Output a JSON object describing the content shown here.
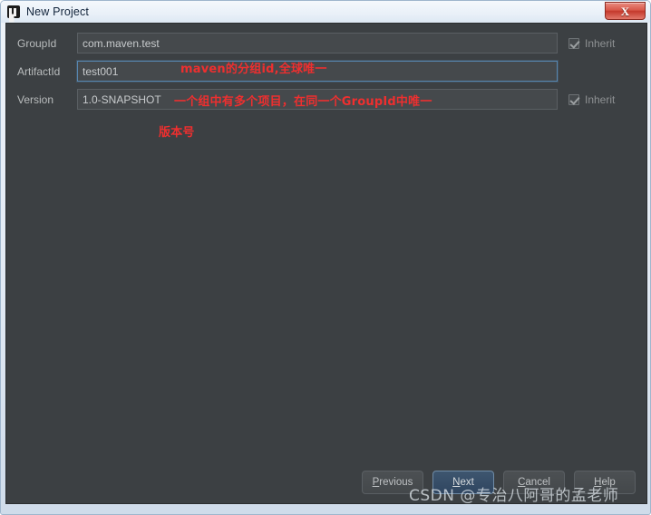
{
  "window": {
    "title": "New Project",
    "app_icon": "intellij-idea-icon",
    "close_label": "X",
    "frame_color": "#cfdcea",
    "panel_color": "#3c4043"
  },
  "form": {
    "rows": [
      {
        "label": "GroupId",
        "value": "com.maven.test",
        "focused": false,
        "inherit": {
          "label": "Inherit",
          "checked": true,
          "visible": true
        }
      },
      {
        "label": "ArtifactId",
        "value": "test001",
        "focused": true,
        "inherit": {
          "label": "",
          "checked": false,
          "visible": false
        }
      },
      {
        "label": "Version",
        "value": "1.0-SNAPSHOT",
        "focused": false,
        "inherit": {
          "label": "Inherit",
          "checked": true,
          "visible": true
        }
      }
    ]
  },
  "annotations": {
    "color": "#ee2f2f",
    "items": [
      {
        "text": "maven的分组id,全球唯一"
      },
      {
        "text": "一个组中有多个项目，在同一个GroupId中唯一"
      },
      {
        "text": "版本号"
      }
    ]
  },
  "footer": {
    "buttons": [
      {
        "label": "Previous",
        "mnemonic": "P",
        "rest": "revious",
        "default": false
      },
      {
        "label": "Next",
        "mnemonic": "N",
        "rest": "ext",
        "default": true
      },
      {
        "label": "Cancel",
        "mnemonic": "C",
        "rest": "ancel",
        "default": false
      },
      {
        "label": "Help",
        "mnemonic": "H",
        "rest": "elp",
        "default": false
      }
    ]
  },
  "watermark": {
    "text": "CSDN @专治八阿哥的孟老师"
  }
}
